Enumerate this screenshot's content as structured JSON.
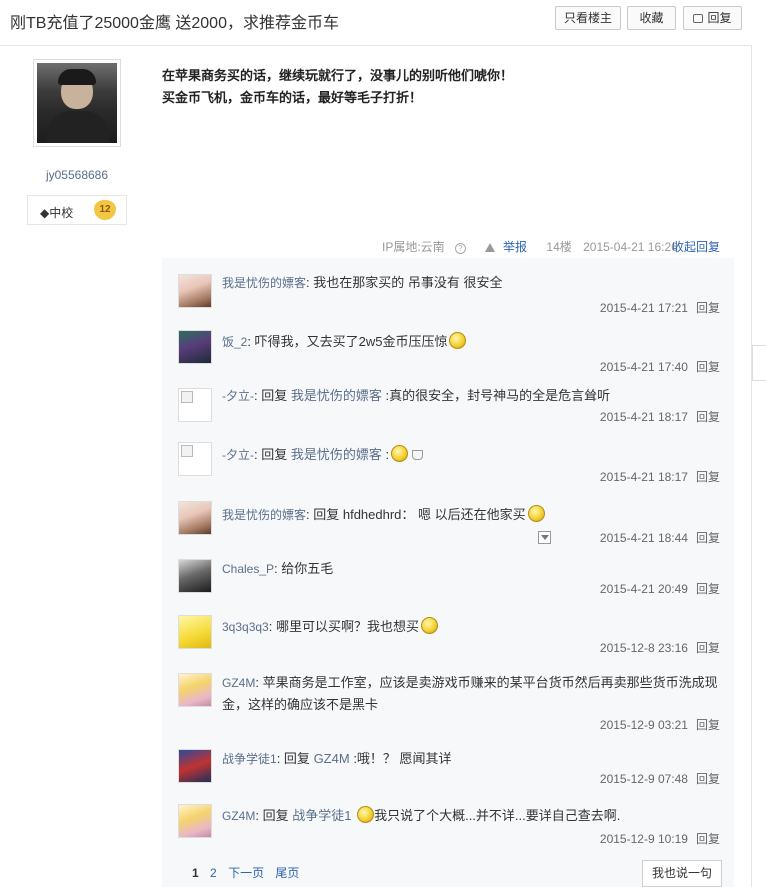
{
  "thread": {
    "title": "刚TB充值了25000金鹰 送2000，求推荐金币车",
    "buttons": {
      "only_op": "只看楼主",
      "favorite": "收藏",
      "reply": "回复"
    }
  },
  "post": {
    "author": {
      "name": "jy05568686",
      "rank": "◆中校",
      "level": "12"
    },
    "lines": [
      "在苹果商务买的话，继续玩就行了，没事儿的别听他们唬你！",
      "买金币飞机，金币车的话，最好等毛子打折！"
    ],
    "meta": {
      "ip_label": "IP属地:云南",
      "info_icon": "?",
      "report": "举报",
      "floor": "14楼",
      "time": "2015-04-21 16:26",
      "collapse": "收起回复"
    }
  },
  "comments": [
    {
      "user": "我是忧伤的嫖客",
      "prefix": "",
      "target": "",
      "text": "我也在那家买的 吊事没有 很安全",
      "time": "2015-4-21 17:21",
      "reply": "回复",
      "avatar": "girl-avatar-icon"
    },
    {
      "user": "饭_2",
      "prefix": "",
      "target": "",
      "text": "吓得我，又去买了2w5金币压压惊",
      "time": "2015-4-21 17:40",
      "reply": "回复",
      "avatar": "game-avatar-icon"
    },
    {
      "user": "-夕立-",
      "prefix": "回复",
      "target": "我是忧伤的嫖客",
      "text": ":真的很安全，封号神马的全是危言耸听",
      "time": "2015-4-21 18:17",
      "reply": "回复",
      "avatar": "broken-avatar-icon"
    },
    {
      "user": "-夕立-",
      "prefix": "回复",
      "target": "我是忧伤的嫖客",
      "text": ":",
      "time": "2015-4-21 18:17",
      "reply": "回复",
      "avatar": "broken-avatar-icon"
    },
    {
      "user": "我是忧伤的嫖客",
      "prefix": "回复 hfdhedhrd：",
      "target": "",
      "text": "嗯 以后还在他家买",
      "time": "2015-4-21 18:44",
      "reply": "回复",
      "avatar": "girl-avatar-icon"
    },
    {
      "user": "Chales_P",
      "prefix": "",
      "target": "",
      "text": "给你五毛",
      "time": "2015-4-21 20:49",
      "reply": "回复",
      "avatar": "man-avatar-icon"
    },
    {
      "user": "3q3q3q3",
      "prefix": "",
      "target": "",
      "text": "哪里可以买啊？我也想买",
      "time": "2015-12-8 23:16",
      "reply": "回复",
      "avatar": "cheese-avatar-icon"
    },
    {
      "user": "GZ4M",
      "prefix": "",
      "target": "",
      "text": "苹果商务是工作室，应该是卖游戏币赚来的某平台货币然后再卖那些货币洗成现金，这样的确应该不是黑卡",
      "time": "2015-12-9 03:21",
      "reply": "回复",
      "avatar": "anime-avatar-icon"
    },
    {
      "user": "战争学徒1",
      "prefix": "回复",
      "target": "GZ4M",
      "text": ":哦！？ 愿闻其详",
      "time": "2015-12-9 07:48",
      "reply": "回复",
      "avatar": "robot-avatar-icon"
    },
    {
      "user": "GZ4M",
      "prefix": "回复",
      "target": "战争学徒1",
      "text": "我只说了个大概...并不详...要详自己查去啊.",
      "time": "2015-12-9 10:19",
      "reply": "回复",
      "avatar": "anime-avatar-icon"
    }
  ],
  "pager": {
    "current": "1",
    "page2": "2",
    "next": "下一页",
    "last": "尾页",
    "say": "我也说一句"
  },
  "colors": {
    "link": "#2d64b3",
    "username": "#5a6f8a",
    "comment_bg": "#f7f8fa"
  }
}
